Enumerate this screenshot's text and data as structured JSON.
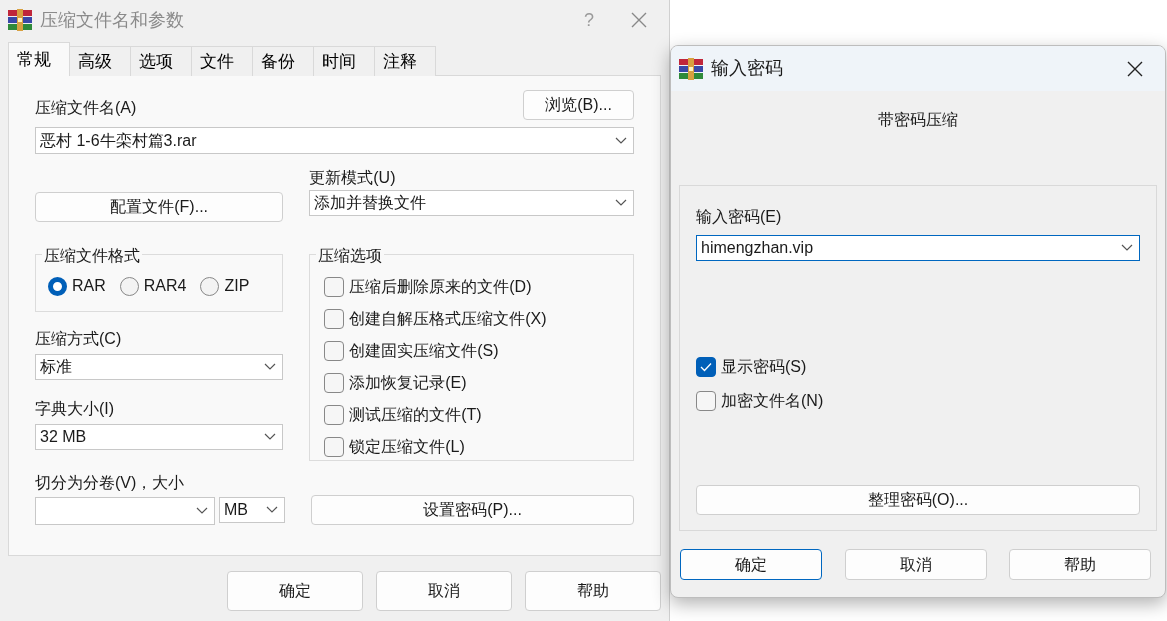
{
  "main_dialog": {
    "title": "压缩文件名和参数",
    "help_button": "?",
    "tabs": [
      {
        "label": "常规",
        "selected": true
      },
      {
        "label": "高级",
        "selected": false
      },
      {
        "label": "选项",
        "selected": false
      },
      {
        "label": "文件",
        "selected": false
      },
      {
        "label": "备份",
        "selected": false
      },
      {
        "label": "时间",
        "selected": false
      },
      {
        "label": "注释",
        "selected": false
      }
    ],
    "archive_name": {
      "label": "压缩文件名(A)",
      "value": "恶村 1-6牛栾村篇3.rar"
    },
    "browse_button": "浏览(B)...",
    "profiles_button": "配置文件(F)...",
    "update_mode": {
      "label": "更新模式(U)",
      "value": "添加并替换文件"
    },
    "archive_format": {
      "legend": "压缩文件格式",
      "options": [
        {
          "label": "RAR",
          "selected": true
        },
        {
          "label": "RAR4",
          "selected": false
        },
        {
          "label": "ZIP",
          "selected": false
        }
      ]
    },
    "compression_method": {
      "label": "压缩方式(C)",
      "value": "标准"
    },
    "dictionary_size": {
      "label": "字典大小(I)",
      "value": "32 MB"
    },
    "split": {
      "label": "切分为分卷(V)，大小",
      "unit": "MB"
    },
    "archiving_options": {
      "legend": "压缩选项",
      "options": [
        {
          "label": "压缩后删除原来的文件(D)",
          "checked": false
        },
        {
          "label": "创建自解压格式压缩文件(X)",
          "checked": false
        },
        {
          "label": "创建固实压缩文件(S)",
          "checked": false
        },
        {
          "label": "添加恢复记录(E)",
          "checked": false
        },
        {
          "label": "测试压缩的文件(T)",
          "checked": false
        },
        {
          "label": "锁定压缩文件(L)",
          "checked": false
        }
      ]
    },
    "set_password_button": "设置密码(P)...",
    "buttons": [
      "确定",
      "取消",
      "帮助"
    ]
  },
  "password_dialog": {
    "title": "输入密码",
    "heading": "带密码压缩",
    "password": {
      "label": "输入密码(E)",
      "value": "himengzhan.vip"
    },
    "options": [
      {
        "label": "显示密码(S)",
        "checked": true
      },
      {
        "label": "加密文件名(N)",
        "checked": false
      }
    ],
    "organize_button": "整理密码(O)...",
    "buttons": [
      {
        "label": "确定",
        "focused": true
      },
      {
        "label": "取消",
        "focused": false
      },
      {
        "label": "帮助",
        "focused": false
      }
    ]
  }
}
